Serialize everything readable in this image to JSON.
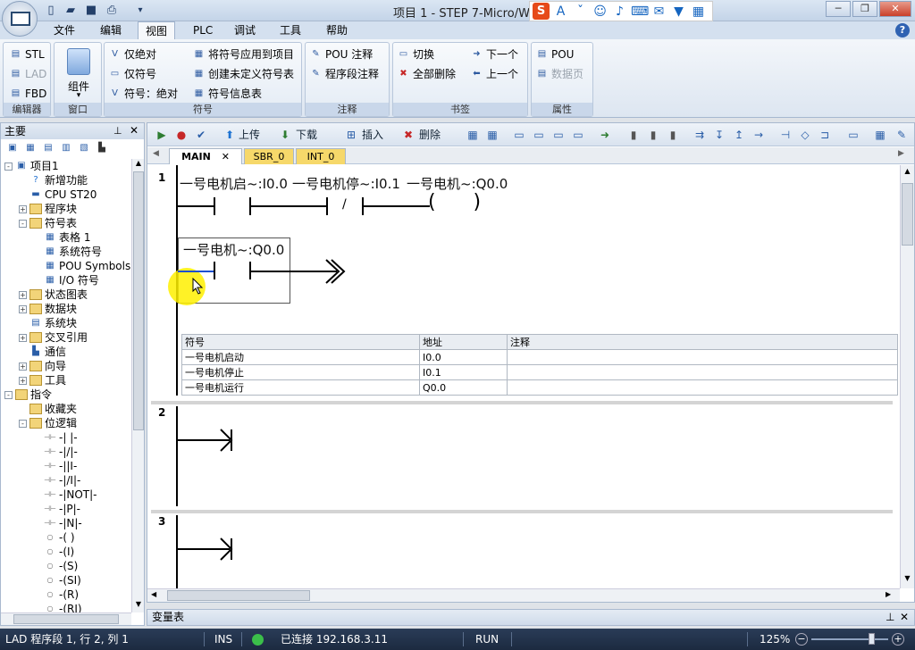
{
  "titlebar": {
    "title": "项目 1 - STEP 7-Micro/WIN"
  },
  "menu": [
    "文件",
    "编辑",
    "视图",
    "PLC",
    "调试",
    "工具",
    "帮助"
  ],
  "ribbon": {
    "editor": {
      "label": "编辑器",
      "stl": "STL",
      "lad": "LAD",
      "fbd": "FBD"
    },
    "window": {
      "label": "窗口",
      "components": "组件"
    },
    "symbols": {
      "label": "符号",
      "abs_only": "仅绝对",
      "sym_only": "仅符号",
      "sym_abs": "符号：绝对",
      "apply": "将符号应用到项目",
      "create_undef": "创建未定义符号表",
      "info": "符号信息表"
    },
    "comments": {
      "label": "注释",
      "pou": "POU 注释",
      "network": "程序段注释"
    },
    "bookmarks": {
      "label": "书签",
      "toggle": "切换",
      "delete_all": "全部删除",
      "next": "下一个",
      "prev": "上一个"
    },
    "properties": {
      "label": "属性",
      "pou": "POU",
      "data_page": "数据页"
    }
  },
  "panel": {
    "title": "主要"
  },
  "tree": [
    {
      "label": "项目1",
      "level": 0,
      "icon": "project-icon",
      "exp": "-"
    },
    {
      "label": "新增功能",
      "level": 1,
      "icon": "help-icon",
      "exp": ""
    },
    {
      "label": "CPU ST20",
      "level": 1,
      "icon": "cpu-icon",
      "exp": ""
    },
    {
      "label": "程序块",
      "level": 1,
      "icon": "folder-icon",
      "exp": "+"
    },
    {
      "label": "符号表",
      "level": 1,
      "icon": "folder-icon",
      "exp": "-"
    },
    {
      "label": "表格 1",
      "level": 2,
      "icon": "table-icon",
      "exp": ""
    },
    {
      "label": "系统符号",
      "level": 2,
      "icon": "table-icon",
      "exp": ""
    },
    {
      "label": "POU Symbols",
      "level": 2,
      "icon": "table-icon",
      "exp": ""
    },
    {
      "label": "I/O 符号",
      "level": 2,
      "icon": "table-icon",
      "exp": ""
    },
    {
      "label": "状态图表",
      "level": 1,
      "icon": "folder-icon",
      "exp": "+"
    },
    {
      "label": "数据块",
      "level": 1,
      "icon": "folder-icon",
      "exp": "+"
    },
    {
      "label": "系统块",
      "level": 1,
      "icon": "system-block-icon",
      "exp": ""
    },
    {
      "label": "交叉引用",
      "level": 1,
      "icon": "folder-icon",
      "exp": "+"
    },
    {
      "label": "通信",
      "level": 1,
      "icon": "comm-icon",
      "exp": ""
    },
    {
      "label": "向导",
      "level": 1,
      "icon": "folder-icon",
      "exp": "+"
    },
    {
      "label": "工具",
      "level": 1,
      "icon": "folder-icon",
      "exp": "+"
    },
    {
      "label": "指令",
      "level": 0,
      "icon": "folder-icon",
      "exp": "-"
    },
    {
      "label": "收藏夹",
      "level": 1,
      "icon": "folder-icon",
      "exp": ""
    },
    {
      "label": "位逻辑",
      "level": 1,
      "icon": "folder-icon",
      "exp": "-"
    },
    {
      "label": "-| |-",
      "level": 2,
      "icon": "instr-icon",
      "exp": ""
    },
    {
      "label": "-|/|-",
      "level": 2,
      "icon": "instr-icon",
      "exp": ""
    },
    {
      "label": "-||I-",
      "level": 2,
      "icon": "instr-icon",
      "exp": ""
    },
    {
      "label": "-|/I|-",
      "level": 2,
      "icon": "instr-icon",
      "exp": ""
    },
    {
      "label": "-|NOT|-",
      "level": 2,
      "icon": "instr-icon",
      "exp": ""
    },
    {
      "label": "-|P|-",
      "level": 2,
      "icon": "instr-icon",
      "exp": ""
    },
    {
      "label": "-|N|-",
      "level": 2,
      "icon": "instr-icon",
      "exp": ""
    },
    {
      "label": "-( )",
      "level": 2,
      "icon": "coil-icon",
      "exp": ""
    },
    {
      "label": "-(I)",
      "level": 2,
      "icon": "coil-icon",
      "exp": ""
    },
    {
      "label": "-(S)",
      "level": 2,
      "icon": "coil-icon",
      "exp": ""
    },
    {
      "label": "-(SI)",
      "level": 2,
      "icon": "coil-icon",
      "exp": ""
    },
    {
      "label": "-(R)",
      "level": 2,
      "icon": "coil-icon",
      "exp": ""
    },
    {
      "label": "-(RI)",
      "level": 2,
      "icon": "coil-icon",
      "exp": ""
    }
  ],
  "toolbar": {
    "upload": "上传",
    "download": "下载",
    "insert": "插入",
    "delete": "删除"
  },
  "tabs": [
    {
      "label": "MAIN",
      "active": true
    },
    {
      "label": "SBR_0",
      "active": false
    },
    {
      "label": "INT_0",
      "active": false
    }
  ],
  "networks": [
    {
      "num": "1",
      "label1": "一号电机启~:I0.0",
      "label2": "一号电机停~:I0.1",
      "label3": "一号电机~:Q0.0",
      "label4": "一号电机~:Q0.0"
    },
    {
      "num": "2"
    },
    {
      "num": "3"
    }
  ],
  "symtable": {
    "headers": [
      "符号",
      "地址",
      "注释"
    ],
    "rows": [
      [
        "一号电机启动",
        "I0.0",
        ""
      ],
      [
        "一号电机停止",
        "I0.1",
        ""
      ],
      [
        "一号电机运行",
        "Q0.0",
        ""
      ]
    ]
  },
  "vartable": {
    "title": "变量表"
  },
  "status": {
    "pos": "LAD 程序段 1, 行 2, 列 1",
    "mode": "INS",
    "conn": "已连接 192.168.3.11",
    "run": "RUN",
    "zoom": "125%"
  }
}
